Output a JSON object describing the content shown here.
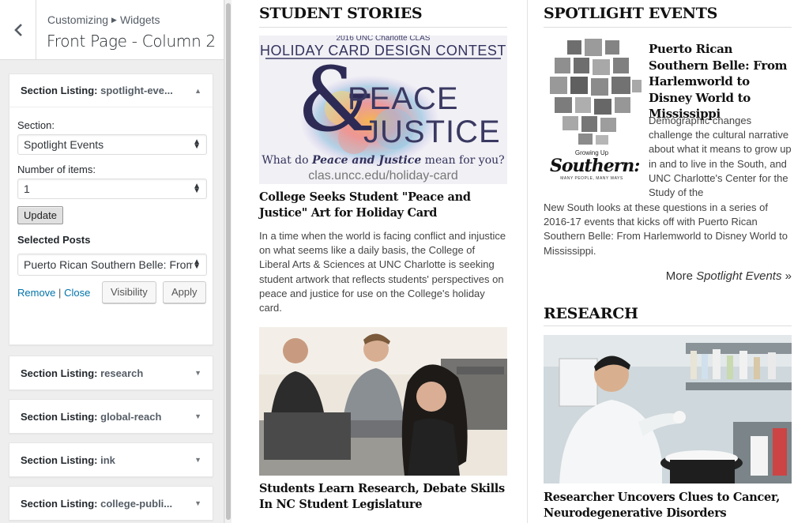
{
  "customizer": {
    "breadcrumb": [
      "Customizing",
      "Widgets"
    ],
    "title": "Front Page - Column 2",
    "open_widget": {
      "title_prefix": "Section Listing:",
      "title_suffix": "spotlight-eve...",
      "section_label": "Section:",
      "section_value": "Spotlight Events",
      "items_label": "Number of items:",
      "items_value": "1",
      "update_label": "Update",
      "selected_posts_label": "Selected Posts",
      "selected_post_value": "Puerto Rican Southern Belle: From Ha",
      "remove_label": "Remove",
      "link_separator": "|",
      "close_label": "Close",
      "visibility_label": "Visibility",
      "apply_label": "Apply"
    },
    "collapsed_widgets": [
      {
        "prefix": "Section Listing:",
        "suffix": "research"
      },
      {
        "prefix": "Section Listing:",
        "suffix": "global-reach"
      },
      {
        "prefix": "Section Listing:",
        "suffix": "ink"
      },
      {
        "prefix": "Section Listing:",
        "suffix": "college-publi..."
      }
    ]
  },
  "preview": {
    "student_stories": {
      "heading": "STUDENT STORIES",
      "card_image": {
        "top_line": "2016 UNC Charlotte CLAS",
        "banner": "HOLIDAY  CARD DESIGN CONTEST",
        "peace": "PEACE",
        "justice": "JUSTICE",
        "ampersand": "&",
        "question_pre": "What do ",
        "question_em": "Peace and Justice",
        "question_post": " mean for you?",
        "url": "clas.uncc.edu/holiday-card"
      },
      "story1_title": "College Seeks Student \"Peace and Justice\" Art for Holiday Card",
      "story1_text": "In a time when the world is facing conflict and injustice on what seems like a daily basis, the College of Liberal Arts & Sciences at UNC Charlotte is seeking student artwork that reflects students' perspectives on peace and justice for use on the College's holiday card.",
      "story2_title": "Students Learn Research, Debate Skills In NC Student Legislature"
    },
    "spotlight": {
      "heading": "SPOTLIGHT EVENTS",
      "image_caption_small": "Growing Up",
      "image_caption_big": "Southern:",
      "image_caption_tag": "MANY PEOPLE, MANY WAYS",
      "title": "Puerto Rican Southern Belle: From Harlemworld to Disney World to Mississippi",
      "text_side": "Demographic changes challenge the cultural narrative about what it means to grow up in and to live in the South, and UNC Charlotte's Center for the Study of the",
      "text_full": "New South looks at these questions in a series of 2016-17 events that kicks off with Puerto Rican Southern Belle: From Harlemworld to Disney World to Mississippi.",
      "more_pre": "More ",
      "more_em": "Spotlight Events",
      "more_post": " »"
    },
    "research": {
      "heading": "RESEARCH",
      "title": "Researcher Uncovers Clues to Cancer, Neurodegenerative Disorders"
    }
  },
  "colors": {
    "link": "#0073aa",
    "sidebar_bg": "#eeeeee"
  }
}
